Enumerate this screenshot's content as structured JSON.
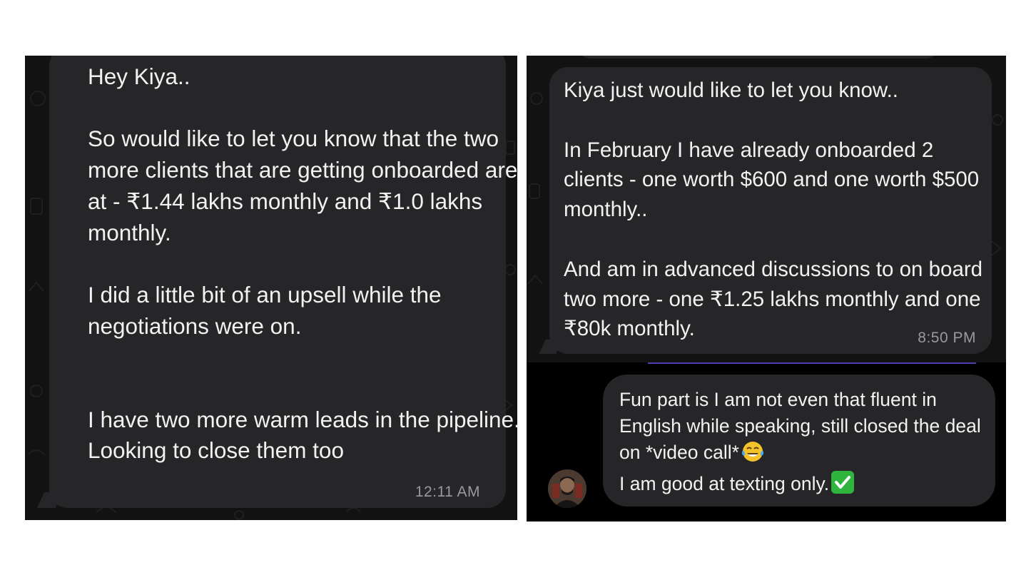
{
  "left_panel": {
    "message": "Hey Kiya..\n\nSo would like to let you know that the two more clients that are getting onboarded are at - ₹1.44 lakhs monthly and ₹1.0 lakhs monthly.\n\nI did a little bit of an upsell while the negotiations were on.\n\n\nI have two more warm leads in the pipeline.. Looking to close them too",
    "timestamp": "12:11 AM"
  },
  "right_top_panel": {
    "message": "Kiya just would like to let you know..\n\nIn February I have already onboarded 2 clients - one worth $600 and one worth $500 monthly..\n\nAnd am in advanced discussions to on board two more - one ₹1.25 lakhs monthly and one ₹80k monthly.",
    "timestamp": "8:50 PM"
  },
  "right_bottom_panel": {
    "reply_line_1": "Fun part is I am not even that fluent in English while speaking, still closed the deal on *video call*",
    "reply_line_2": "I am good at texting only.",
    "emoji_1": "laughing-tears-icon",
    "emoji_2": "green-check-icon",
    "avatar": "profile-avatar"
  },
  "colors": {
    "bubble": "#262628",
    "panel_bg": "#121212",
    "timestamp": "#9a9a9c",
    "check": "#2fb53e"
  }
}
